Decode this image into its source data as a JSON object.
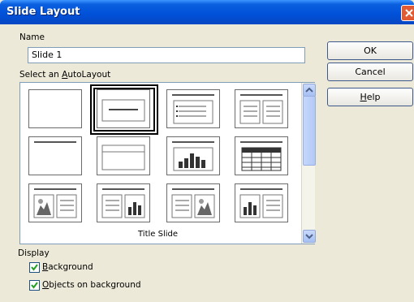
{
  "dialog": {
    "title": "Slide Layout",
    "name_label": "Name",
    "name_value": "Slide 1",
    "layout_label_pre": "Select an ",
    "layout_label_key": "A",
    "layout_label_post": "utoLayout",
    "selected_caption": "Title Slide",
    "display_label": "Display"
  },
  "buttons": {
    "ok": "OK",
    "cancel": "Cancel",
    "help_key": "H",
    "help_post": "elp"
  },
  "layouts": [
    "blank",
    "title",
    "bulleted",
    "two-column-text",
    "title-only",
    "title-caption",
    "chart",
    "table",
    "clipart-text",
    "text-chart",
    "text-clipart",
    "chart-text"
  ],
  "options": [
    {
      "key": "B",
      "post": "ackground",
      "checked": true
    },
    {
      "key": "O",
      "post": "bjects on background",
      "checked": true
    }
  ]
}
